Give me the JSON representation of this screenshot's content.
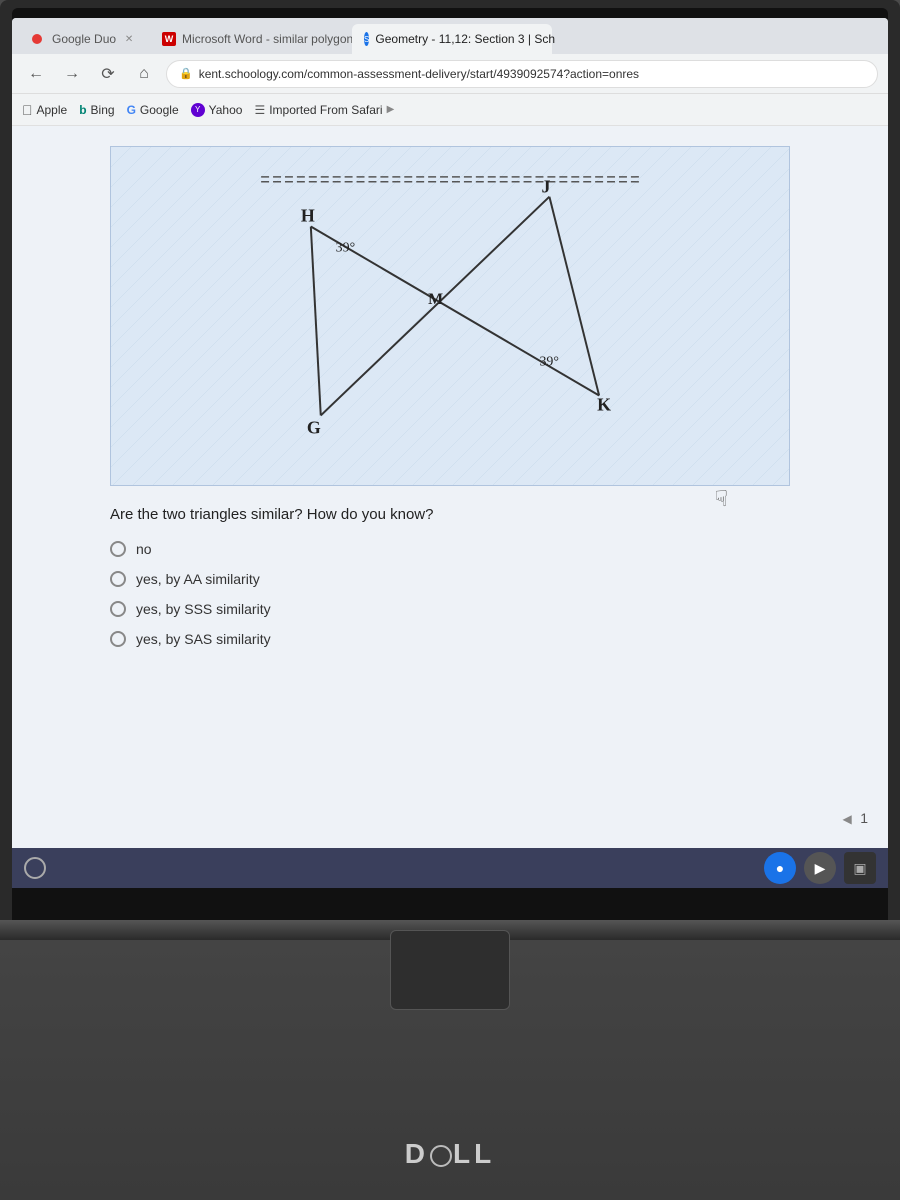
{
  "browser": {
    "tabs": [
      {
        "id": "google-duo",
        "label": "Google Duo",
        "type": "duo",
        "active": false
      },
      {
        "id": "ms-word",
        "label": "Microsoft Word - similar polygon",
        "type": "word",
        "active": false
      },
      {
        "id": "schoology",
        "label": "Geometry - 11,12: Section 3 | Sch",
        "type": "schoology",
        "active": true
      }
    ],
    "address": "kent.schoology.com/common-assessment-delivery/start/4939092574?action=onres",
    "bookmarks": [
      {
        "id": "apple",
        "label": "Apple",
        "icon": "apple"
      },
      {
        "id": "bing",
        "label": "Bing",
        "icon": "bing"
      },
      {
        "id": "google",
        "label": "Google",
        "icon": "google"
      },
      {
        "id": "yahoo",
        "label": "Yahoo",
        "icon": "yahoo"
      },
      {
        "id": "imported",
        "label": "Imported From Safari",
        "icon": "safari"
      }
    ]
  },
  "question": {
    "text": "Are the two triangles similar?  How do you know?",
    "options": [
      {
        "id": "no",
        "label": "no"
      },
      {
        "id": "yes-aa",
        "label": "yes, by AA similarity"
      },
      {
        "id": "yes-sss",
        "label": "yes, by SSS similarity"
      },
      {
        "id": "yes-sas",
        "label": "yes, by SAS similarity"
      }
    ]
  },
  "diagram": {
    "angle1": "39°",
    "angle2": "39°",
    "points": {
      "H": "H",
      "J": "J",
      "M": "M",
      "G": "G",
      "K": "K"
    }
  },
  "page": {
    "number": "1"
  },
  "dell_logo": "DELL",
  "taskbar": {
    "circle_title": "Start"
  }
}
